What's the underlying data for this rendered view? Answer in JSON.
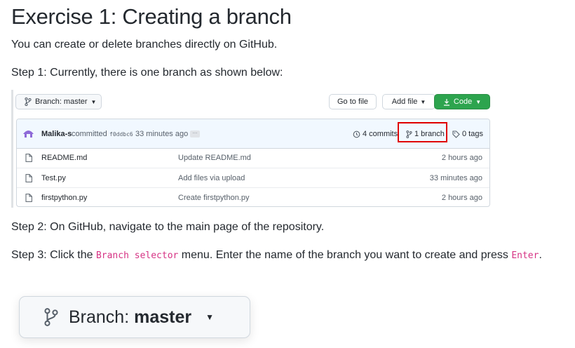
{
  "heading": "Exercise 1: Creating a branch",
  "intro": "You can create or delete branches directly on GitHub.",
  "step1": "Step 1: Currently, there is one branch as shown below:",
  "step2": "Step 2: On GitHub, navigate to the main page of the repository.",
  "step3": {
    "pre": "Step 3: Click the ",
    "code1": "Branch selector",
    "mid": " menu. Enter the name of the branch you want to create and press ",
    "code2": "Enter",
    "post": "."
  },
  "repo": {
    "branch_button": {
      "prefix": "Branch:",
      "value": "master",
      "icon": "git-branch-icon"
    },
    "goto_file": "Go to file",
    "add_file": "Add file",
    "code_button": "Code",
    "commit": {
      "author": "Malika-s",
      "verb": "committed",
      "sha": "f0ddbc6",
      "age": "33 minutes ago",
      "ellipsis": "…"
    },
    "stats": {
      "commits": "4 commits",
      "branch": "1 branch",
      "tags": "0 tags"
    },
    "files": [
      {
        "name": "README.md",
        "message": "Update README.md",
        "age": "2 hours ago"
      },
      {
        "name": "Test.py",
        "message": "Add files via upload",
        "age": "33 minutes ago"
      },
      {
        "name": "firstpython.py",
        "message": "Create firstpython.py",
        "age": "2 hours ago"
      }
    ],
    "highlight_color": "#e00000",
    "code_button_color": "#2da44e"
  },
  "zoom_branch_button": {
    "prefix": "Branch:",
    "value": "master",
    "icon": "git-branch-icon"
  }
}
